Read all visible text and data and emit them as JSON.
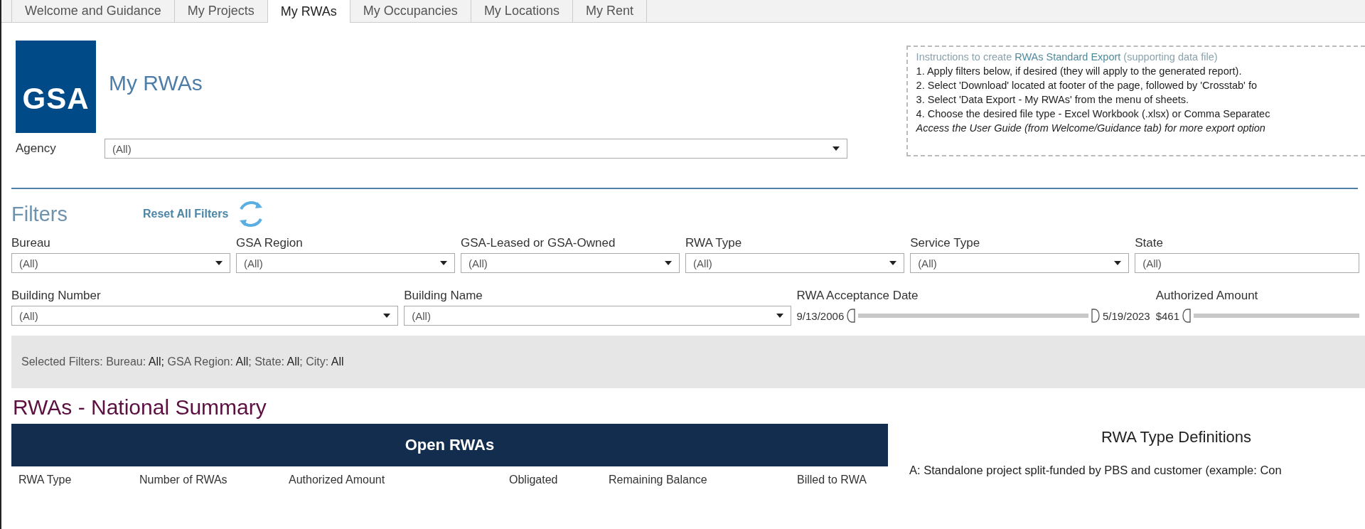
{
  "tabs": [
    {
      "label": "Welcome and Guidance",
      "selected": false
    },
    {
      "label": "My Projects",
      "selected": false
    },
    {
      "label": "My RWAs",
      "selected": true
    },
    {
      "label": "My Occupancies",
      "selected": false
    },
    {
      "label": "My Locations",
      "selected": false
    },
    {
      "label": "My Rent",
      "selected": false
    }
  ],
  "logo": {
    "text": "GSA"
  },
  "page_title": "My RWAs",
  "agency": {
    "label": "Agency",
    "value": "(All)"
  },
  "instructions": {
    "title": "Instructions to create **RWAs Standard Export** (supporting data file)",
    "steps": [
      "1. Apply filters below, if desired (they will apply to the generated report).",
      "2. Select 'Download' located at footer of the page, followed by 'Crosstab' fo",
      "3. Select 'Data Export - My RWAs' from the menu of sheets.",
      "4. Choose the desired file type - Excel Workbook (.xlsx) or Comma Separatec"
    ],
    "note": "Access the User Guide (from Welcome/Guidance tab) for more export option"
  },
  "filters": {
    "title": "Filters",
    "reset_label": "Reset All Filters",
    "row_1": [
      {
        "kind": "dropdown",
        "label": "Bureau",
        "value": "(All)",
        "caret": true
      },
      {
        "kind": "dropdown",
        "label": "GSA Region",
        "value": "(All)",
        "caret": true
      },
      {
        "kind": "dropdown",
        "label": "GSA-Leased or GSA-Owned",
        "value": "(All)",
        "caret": true
      },
      {
        "kind": "dropdown",
        "label": "RWA Type",
        "value": "(All)",
        "caret": true
      },
      {
        "kind": "dropdown",
        "label": "Service Type",
        "value": "(All)",
        "caret": true
      },
      {
        "kind": "dropdown",
        "label": "State",
        "value": "(All)",
        "caret": false
      }
    ],
    "row_2": [
      {
        "kind": "dropdown",
        "label": "Building Number",
        "value": "(All)",
        "caret": true
      },
      {
        "kind": "dropdown",
        "label": "Building Name",
        "value": "(All)",
        "caret": true
      },
      {
        "kind": "slider",
        "label": "RWA Acceptance Date",
        "min_label": "9/13/2006",
        "max_label": "5/19/2023",
        "level": 1
      },
      {
        "kind": "slider",
        "label": "Authorized Amount",
        "min_label": "$461",
        "level": 1
      }
    ]
  },
  "selected_filters": "Selected Filters: Bureau: **All;** GSA Region: **All**; State: **All**; City: **All**",
  "summary": {
    "title": "RWAs - National Summary",
    "banner": "Open RWAs",
    "columns": [
      "RWA Type",
      "Number of RWAs",
      "Authorized Amount",
      "Obligated",
      "Remaining Balance",
      "Billed to RWA"
    ],
    "definitions_title": "RWA Type Definitions",
    "definitions": [
      "A: Standalone project split-funded by PBS and customer (example: Con"
    ]
  }
}
